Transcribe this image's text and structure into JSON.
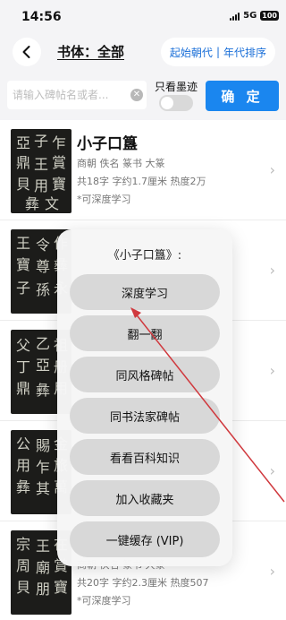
{
  "status": {
    "time": "14:56",
    "network": "5G",
    "battery": "100"
  },
  "nav": {
    "style_label": "书体：全部",
    "sort_start": "起始朝代",
    "sort_sep": "|",
    "sort_era": "年代排序"
  },
  "search": {
    "placeholder": "请输入碑帖名或者...",
    "ink_only_label": "只看墨迹",
    "confirm_label": "确 定"
  },
  "list": [
    {
      "title": "小子口簋",
      "meta": "商朝 佚名 篆书 大篆",
      "stats": "共18字 字约1.7厘米 热度2万",
      "note": "*可深度学习"
    },
    {
      "title": "",
      "meta": "",
      "stats": "",
      "note": ""
    },
    {
      "title": "",
      "meta": "",
      "stats": "",
      "note": ""
    },
    {
      "title": "",
      "meta": "",
      "stats": "",
      "note": ""
    },
    {
      "title": "",
      "meta": "商朝 佚名 篆书 大篆",
      "stats": "共20字 字约2.3厘米 热度507",
      "note": "*可深度学习"
    }
  ],
  "popup": {
    "title": "《小子口簋》:",
    "options": [
      "深度学习",
      "翻一翻",
      "同风格碑帖",
      "同书法家碑帖",
      "看看百科知识",
      "加入收藏夹",
      "一键缓存 (VIP)"
    ]
  },
  "colors": {
    "accent": "#1a86ef",
    "annotation_arrow": "#d0393e"
  }
}
